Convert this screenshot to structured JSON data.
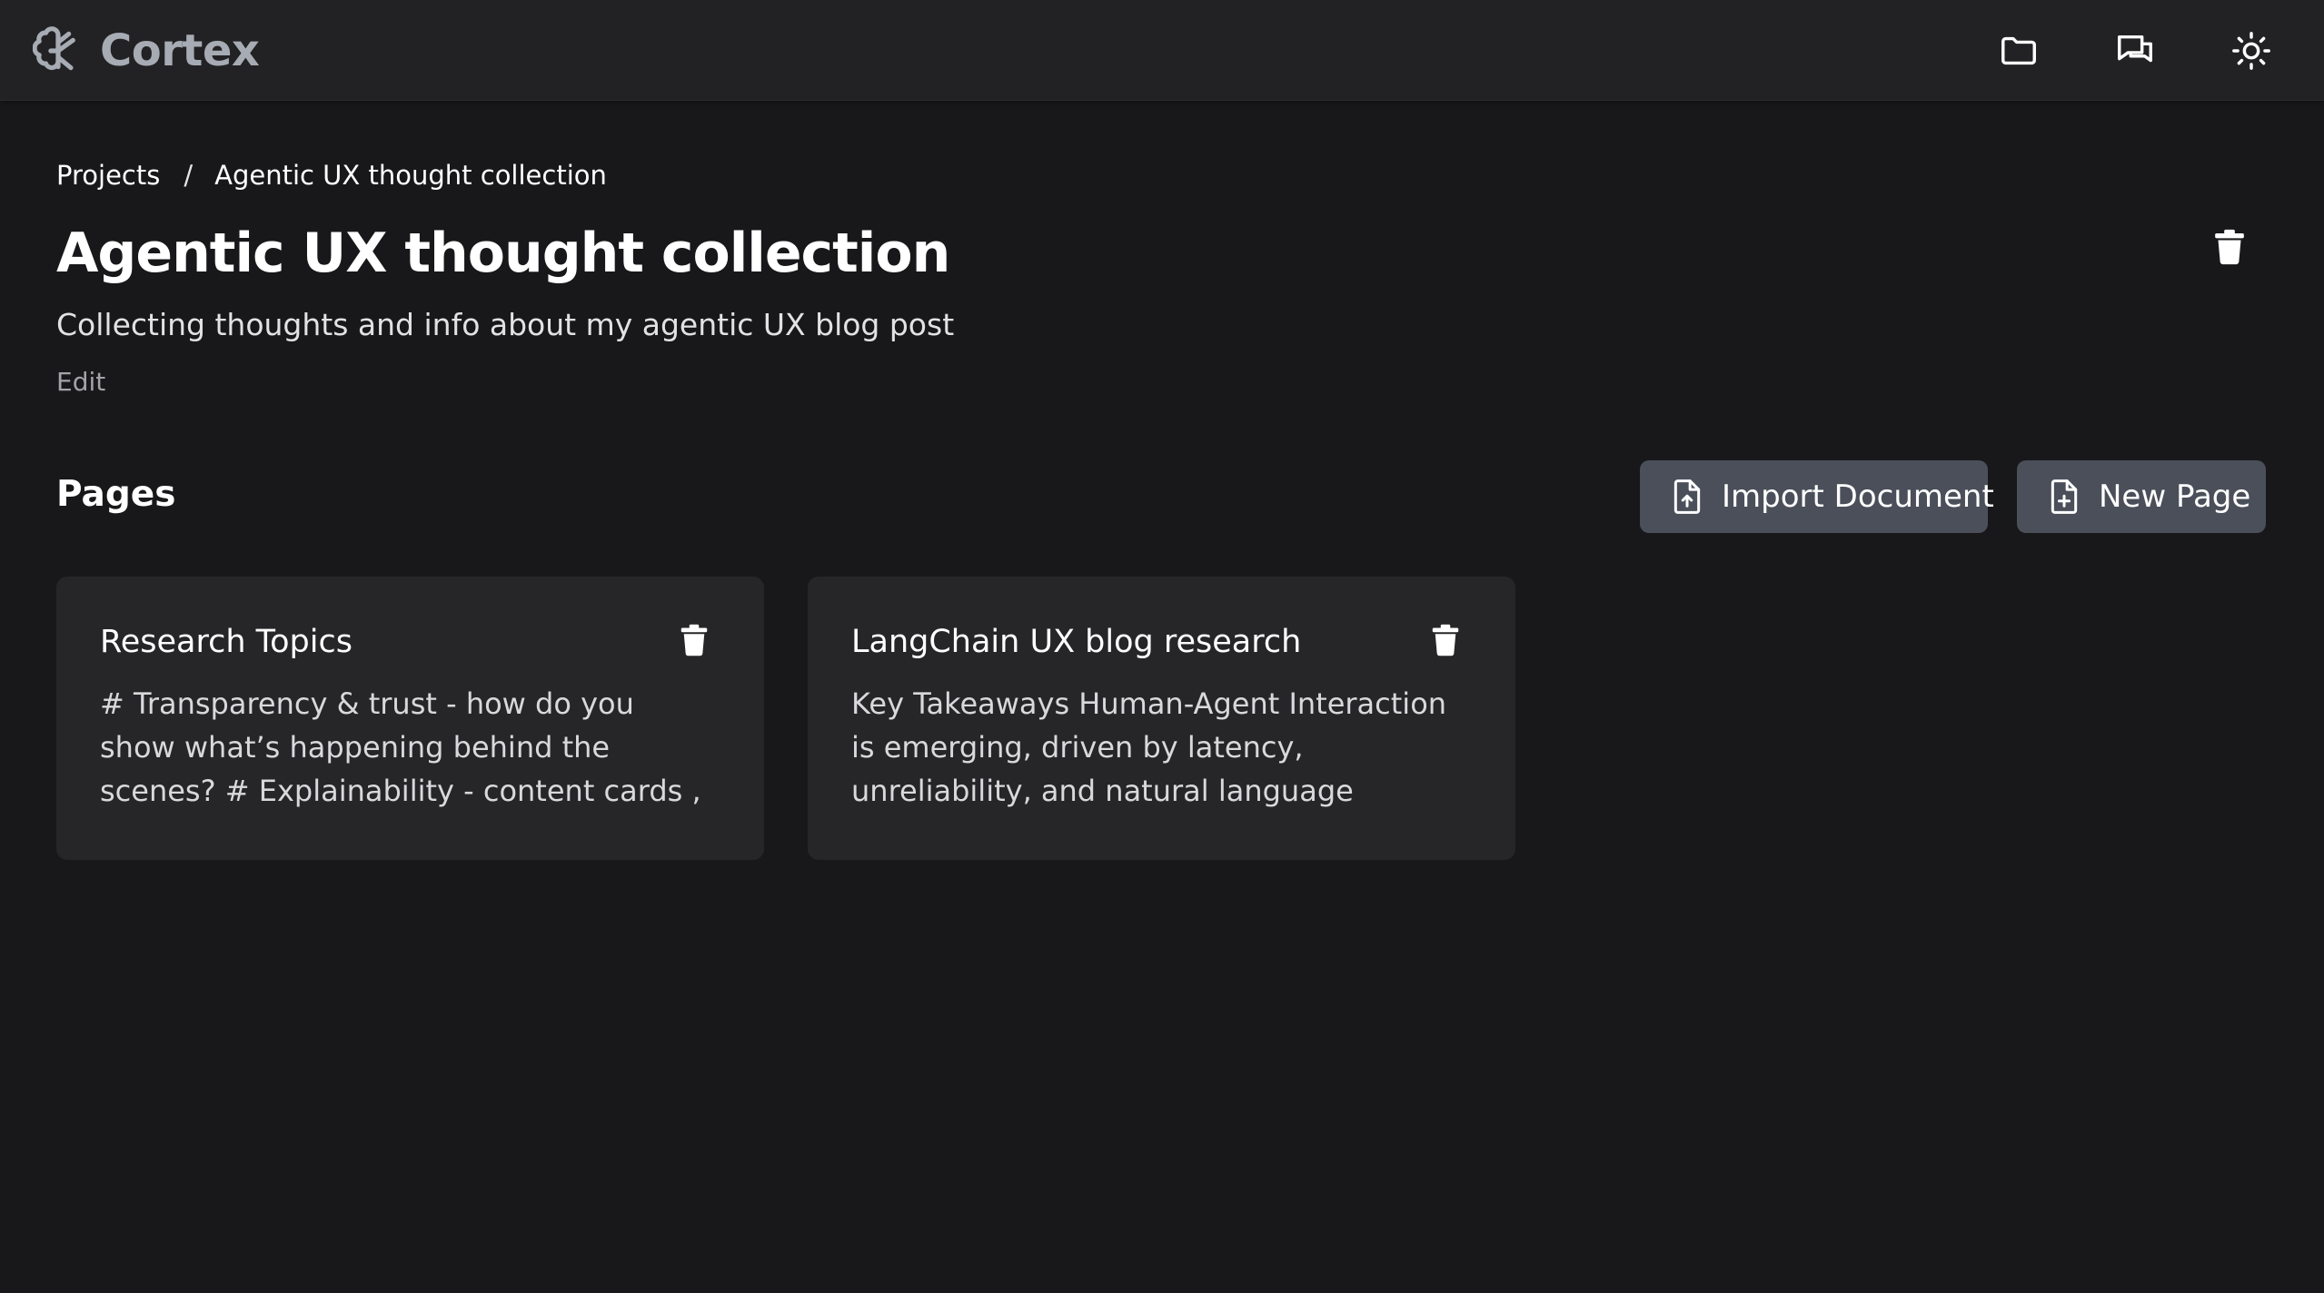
{
  "app": {
    "name": "Cortex",
    "logo_icon": "brain-icon",
    "brand_color": "#a7abb3"
  },
  "nav": [
    {
      "name": "projects",
      "icon": "folder-icon"
    },
    {
      "name": "chat",
      "icon": "chat-icon"
    },
    {
      "name": "theme",
      "icon": "sun-icon"
    }
  ],
  "breadcrumb": {
    "root": "Projects",
    "separator": "/",
    "current": "Agentic UX thought collection"
  },
  "project": {
    "title": "Agentic UX thought collection",
    "description": "Collecting thoughts and info about my agentic UX blog post",
    "edit_label": "Edit",
    "delete_icon": "trash-icon"
  },
  "pages_section": {
    "title": "Pages",
    "import_label": "Import Document",
    "import_icon": "file-import-icon",
    "new_label": "New Page",
    "new_icon": "file-plus-icon",
    "button_color": "#4a4f5a"
  },
  "pages": [
    {
      "title": "Research Topics",
      "excerpt": "# Transparency & trust - how do you show what’s happening behind the scenes? # Explainability - content cards , agentic...",
      "delete_icon": "trash-icon"
    },
    {
      "title": "LangChain UX blog research",
      "excerpt": "Key Takeaways Human-Agent Interaction is emerging, driven by latency, unreliability, and natural language interfaces. Streaming...",
      "delete_icon": "trash-icon"
    }
  ],
  "colors": {
    "background": "#18181a",
    "topbar": "#222224",
    "card": "#262629"
  }
}
